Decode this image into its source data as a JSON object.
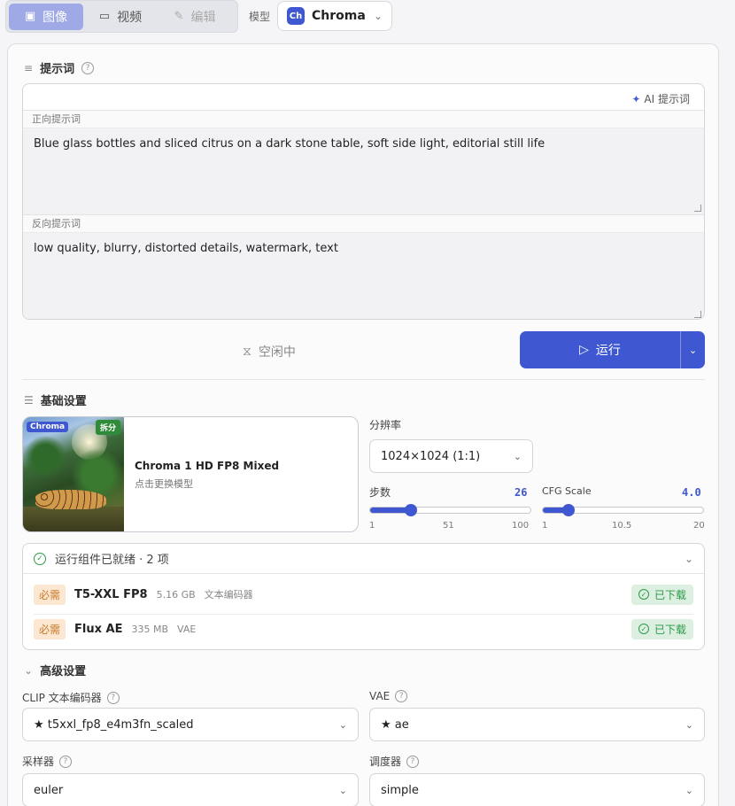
{
  "modes": [
    {
      "label": "图像",
      "icon": "image-icon",
      "active": true
    },
    {
      "label": "视频",
      "icon": "video-icon",
      "active": false
    },
    {
      "label": "编辑",
      "icon": "pencil-icon",
      "active": false
    }
  ],
  "model_bar": {
    "label": "模型",
    "badge": "Ch",
    "name": "Chroma"
  },
  "prompt": {
    "section_title": "提示词",
    "ai_hint": "AI 提示词",
    "positive_label": "正向提示词",
    "positive_text": "Blue glass bottles and sliced citrus on a dark stone table, soft side light, editorial still life",
    "negative_label": "反向提示词",
    "negative_text": "low quality, blurry, distorted details, watermark, text"
  },
  "status": {
    "idle": "空闲中",
    "run": "运行"
  },
  "basic": {
    "title": "基础设置",
    "model_card": {
      "tag_left": "Chroma",
      "tag_right": "拆分",
      "name": "Chroma 1 HD FP8 Mixed",
      "sub": "点击更换模型"
    },
    "resolution": {
      "label": "分辨率",
      "value": "1024×1024 (1:1)"
    },
    "steps": {
      "label": "步数",
      "value": "26",
      "min": "1",
      "mid": "51",
      "max": "100",
      "fraction": 0.2525
    },
    "cfg": {
      "label": "CFG Scale",
      "value": "4.0",
      "min": "1",
      "mid": "10.5",
      "max": "20",
      "fraction": 0.1579
    }
  },
  "components": {
    "header": "运行组件已就绪 · 2 项",
    "items": [
      {
        "req": "必需",
        "name": "T5-XXL FP8",
        "size": "5.16 GB",
        "kind": "文本编码器",
        "status": "已下载"
      },
      {
        "req": "必需",
        "name": "Flux AE",
        "size": "335 MB",
        "kind": "VAE",
        "status": "已下载"
      }
    ]
  },
  "advanced": {
    "title": "高级设置",
    "clip": {
      "label": "CLIP 文本编码器",
      "value": "★ t5xxl_fp8_e4m3fn_scaled"
    },
    "vae": {
      "label": "VAE",
      "value": "★ ae"
    },
    "sampler": {
      "label": "采样器",
      "value": "euler"
    },
    "scheduler": {
      "label": "调度器",
      "value": "simple"
    }
  },
  "colors": {
    "accent": "#3f57d0",
    "success": "#2e9a4a",
    "required": "#c87a2a"
  }
}
